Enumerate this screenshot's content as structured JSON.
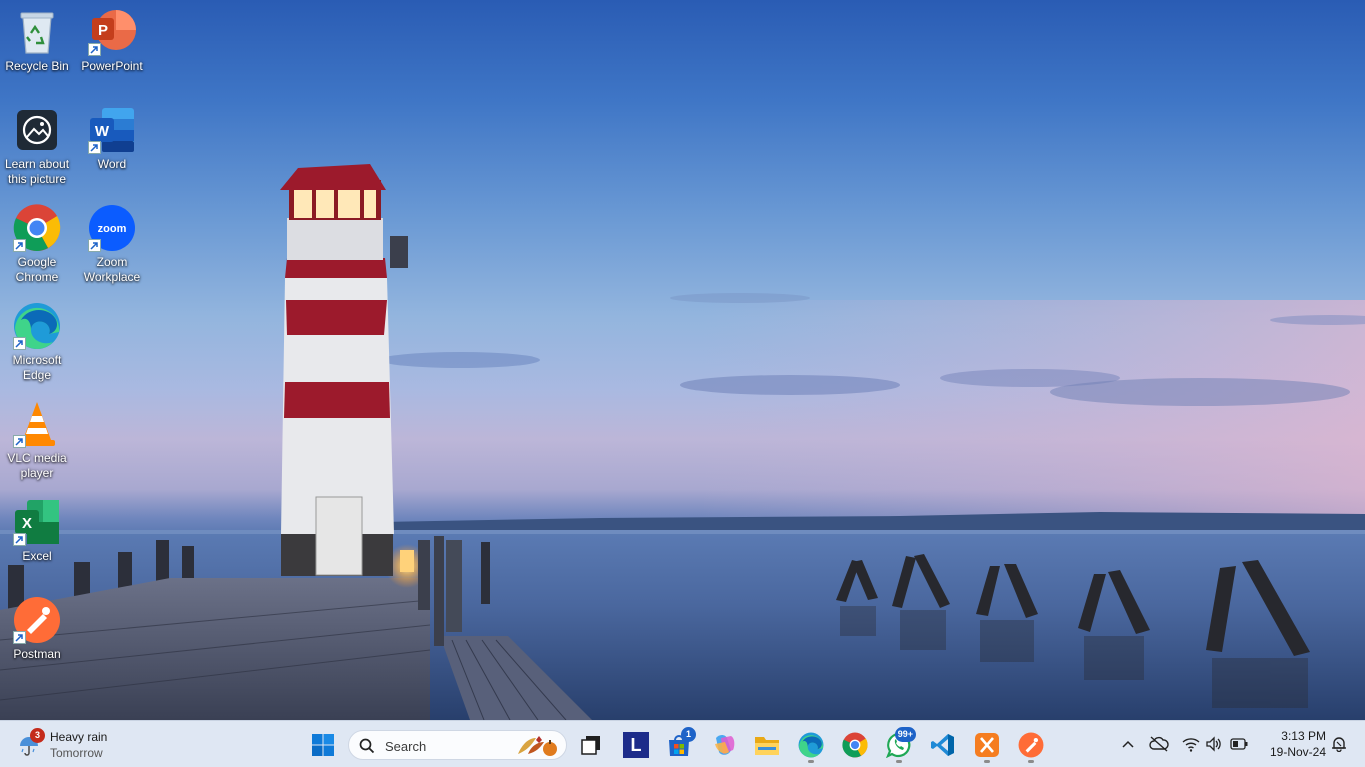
{
  "desktop": {
    "icons": [
      {
        "label": "Recycle Bin",
        "icon": "recycle-bin-icon"
      },
      {
        "label": "PowerPoint",
        "icon": "powerpoint-icon"
      },
      {
        "label": "Learn about this picture",
        "icon": "learn-picture-icon"
      },
      {
        "label": "Word",
        "icon": "word-icon"
      },
      {
        "label": "Google Chrome",
        "icon": "chrome-icon"
      },
      {
        "label": "Zoom Workplace",
        "icon": "zoom-icon"
      },
      {
        "label": "Microsoft Edge",
        "icon": "edge-icon"
      },
      {
        "label": "VLC media player",
        "icon": "vlc-icon"
      },
      {
        "label": "Excel",
        "icon": "excel-icon"
      },
      {
        "label": "Postman",
        "icon": "postman-icon"
      }
    ],
    "powerpoint_letter": "P",
    "word_letter": "W",
    "excel_letter": "X",
    "zoom_text": "zoom"
  },
  "taskbar": {
    "weather": {
      "badge": "3",
      "line1": "Heavy rain",
      "line2": "Tomorrow"
    },
    "search": {
      "placeholder": "Search"
    },
    "apps": [
      {
        "name": "Start",
        "icon": "windows-start-icon"
      },
      {
        "name": "Task View",
        "icon": "task-view-icon"
      },
      {
        "name": "L app",
        "icon": "l-app-icon",
        "letter": "L"
      },
      {
        "name": "Microsoft Store",
        "icon": "store-icon",
        "badge": "1"
      },
      {
        "name": "Copilot",
        "icon": "copilot-icon"
      },
      {
        "name": "File Explorer",
        "icon": "file-explorer-icon"
      },
      {
        "name": "Microsoft Edge",
        "icon": "edge-icon"
      },
      {
        "name": "Google Chrome",
        "icon": "chrome-icon"
      },
      {
        "name": "WhatsApp",
        "icon": "whatsapp-icon",
        "badge": "99+"
      },
      {
        "name": "Visual Studio Code",
        "icon": "vscode-icon"
      },
      {
        "name": "XAMPP",
        "icon": "xampp-icon"
      },
      {
        "name": "Postman",
        "icon": "postman-icon"
      }
    ],
    "tray": {
      "icons": [
        "chevron-up-icon",
        "cloud-offline-icon",
        "wifi-icon",
        "volume-icon",
        "battery-icon",
        "notification-icon"
      ]
    },
    "clock": {
      "time": "3:13 PM",
      "date": "19-Nov-24"
    }
  },
  "colors": {
    "taskbar_bg": "#dfe7f3",
    "accent": "#1e63c8"
  }
}
